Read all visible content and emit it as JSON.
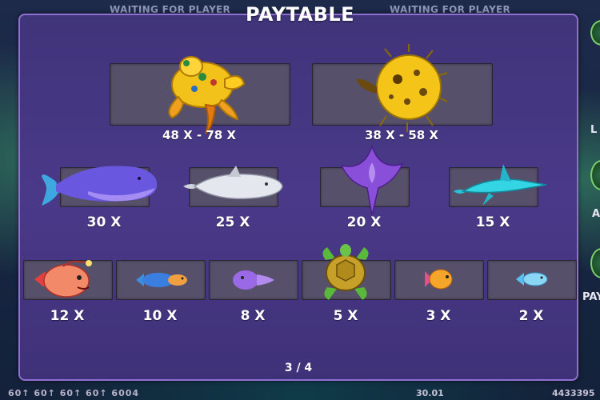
{
  "background": {
    "status_left": "WAITING FOR PLAYER",
    "status_right": "WAITING FOR PLAYER",
    "bottom_bets": "60↑ 60↑ 60↑ 60↑ 6004",
    "bottom_mid": "30.01",
    "bottom_right": "4433395",
    "side_label_1": "L",
    "side_label_2": "A",
    "side_label_3": "PAY"
  },
  "paytable": {
    "title": "PAYTABLE",
    "page_indicator": "3 / 4",
    "rows": [
      [
        {
          "fish": "golden-dragon-turtle",
          "multiplier": "48 X - 78 X"
        },
        {
          "fish": "golden-pufferfish",
          "multiplier": "38 X - 58 X"
        }
      ],
      [
        {
          "fish": "purple-whale",
          "multiplier": "30 X"
        },
        {
          "fish": "silver-shark",
          "multiplier": "25 X"
        },
        {
          "fish": "purple-manta-ray",
          "multiplier": "20 X"
        },
        {
          "fish": "cyan-sawfish",
          "multiplier": "15 X"
        }
      ],
      [
        {
          "fish": "red-anglerfish",
          "multiplier": "12 X"
        },
        {
          "fish": "blue-orange-fish",
          "multiplier": "10 X"
        },
        {
          "fish": "purple-squid",
          "multiplier": "8 X"
        },
        {
          "fish": "green-turtle",
          "multiplier": "5 X"
        },
        {
          "fish": "orange-goldfish",
          "multiplier": "3 X"
        },
        {
          "fish": "small-blue-fish",
          "multiplier": "2 X"
        }
      ]
    ]
  },
  "colors": {
    "panel": "#4a3989",
    "panel_border": "#8f6fd1",
    "slot": "#57506a"
  }
}
